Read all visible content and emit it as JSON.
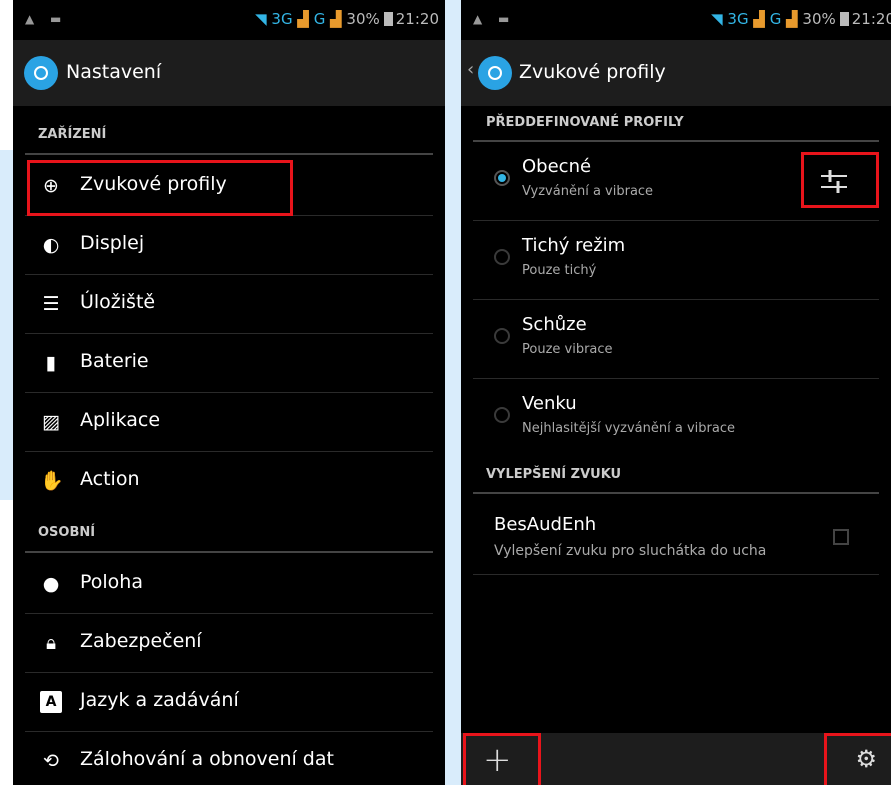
{
  "colors": {
    "accent": "#33b5e5",
    "highlight": "#e8141b",
    "background": "#000000"
  },
  "status_bar": {
    "network_3g": "3G",
    "network_g": "G",
    "battery": "30%",
    "time": "21:20"
  },
  "left_screen": {
    "title": "Nastavení",
    "section_device": "ZAŘÍZENÍ",
    "section_personal": "OSOBNÍ",
    "device_items": [
      {
        "label": "Zvukové profily",
        "icon": "sound-profile-icon"
      },
      {
        "label": "Displej",
        "icon": "display-brightness-icon"
      },
      {
        "label": "Úložiště",
        "icon": "storage-icon"
      },
      {
        "label": "Baterie",
        "icon": "battery-icon"
      },
      {
        "label": "Aplikace",
        "icon": "apps-icon"
      },
      {
        "label": "Action",
        "icon": "hand-gesture-icon"
      }
    ],
    "personal_items": [
      {
        "label": "Poloha",
        "icon": "location-pin-icon"
      },
      {
        "label": "Zabezpečení",
        "icon": "lock-icon"
      },
      {
        "label": "Jazyk a zadávání",
        "icon": "keyboard-language-icon"
      },
      {
        "label": "Zálohování a obnovení dat",
        "icon": "backup-restore-icon"
      }
    ]
  },
  "right_screen": {
    "title": "Zvukové profily",
    "section_predefined": "PŘEDDEFINOVANÉ PROFILY",
    "profiles": [
      {
        "name": "Obecné",
        "desc": "Vyzvánění a vibrace",
        "selected": true
      },
      {
        "name": "Tichý režim",
        "desc": "Pouze tichý",
        "selected": false
      },
      {
        "name": "Schůze",
        "desc": "Pouze vibrace",
        "selected": false
      },
      {
        "name": "Venku",
        "desc": "Nejhlasitější vyzvánění a vibrace",
        "selected": false
      }
    ],
    "section_enhancement": "VYLEPŠENÍ ZVUKU",
    "enhancement": {
      "name": "BesAudEnh",
      "desc": "Vylepšení zvuku pro sluchátka do ucha",
      "checked": false
    },
    "bottom_bar": {
      "add_icon": "plus-icon",
      "settings_icon": "gear-reset-icon"
    }
  }
}
